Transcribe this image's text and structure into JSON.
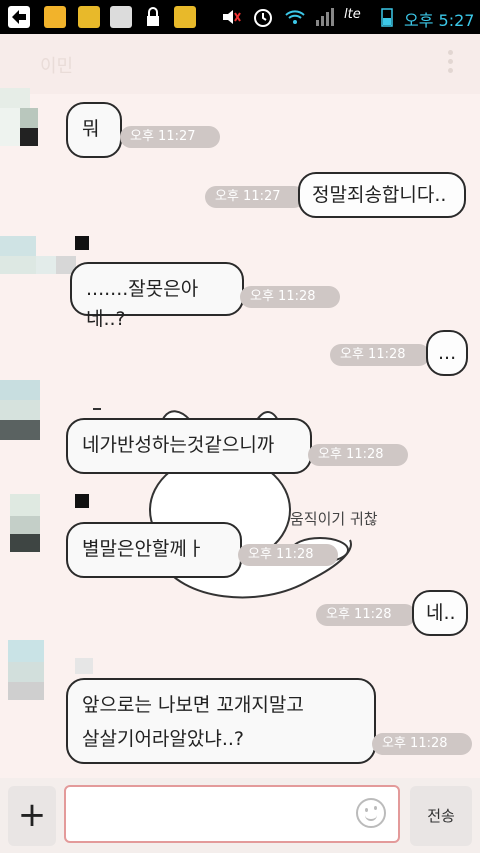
{
  "status_bar": {
    "carrier": "lte",
    "time": "오후 5:27",
    "icons": [
      "back-arrow-icon",
      "notification-icon",
      "app-icon",
      "gallery-icon",
      "lock-icon",
      "app-icon-2",
      "mute-icon",
      "alarm-icon",
      "wifi-icon",
      "signal-icon",
      "battery-icon"
    ]
  },
  "header": {
    "title": "이민"
  },
  "messages": [
    {
      "side": "left",
      "text": "뭐",
      "time": "오후 11:27"
    },
    {
      "side": "right",
      "text": "정말죄송합니다..",
      "time": "오후 11:27"
    },
    {
      "side": "left",
      "text": ".......잘못은아네..?",
      "time": "오후 11:28"
    },
    {
      "side": "right",
      "text": "...",
      "time": "오후 11:28"
    },
    {
      "side": "left",
      "text": "네가반성하는것같으니까",
      "time": "오후 11:28"
    },
    {
      "side": "left",
      "text": "별말은안할께ㅏ",
      "time": "오후 11:28"
    },
    {
      "side": "right",
      "text": "네..",
      "time": "오후 11:28"
    },
    {
      "side": "left",
      "text_line1": "앞으로는 나보면 꼬개지말고",
      "text_line2": "살살기어라알았냐..?",
      "time": "오후 11:28"
    }
  ],
  "sticker": {
    "caption": "움직이기 귀찮"
  },
  "composer": {
    "plus_label": "+",
    "input_value": "",
    "send_label": "전송"
  },
  "colors": {
    "background": "#fbf1ef",
    "bubble_border": "#2a2a2a",
    "time_pill": "#cfc7c5",
    "input_border": "#e39a9a"
  }
}
